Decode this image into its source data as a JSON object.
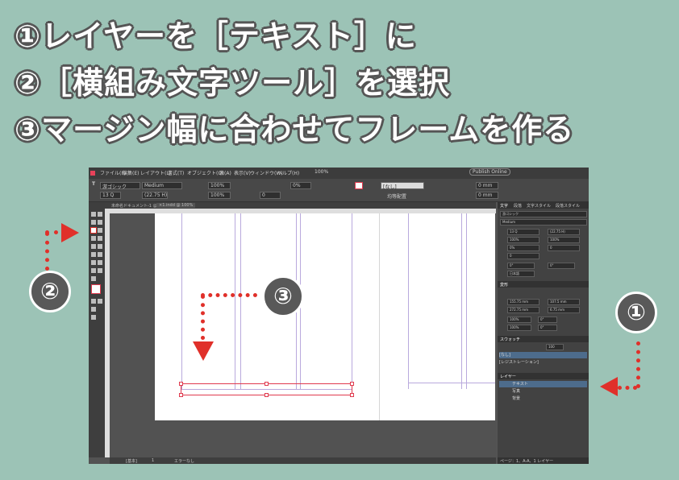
{
  "headings": {
    "line1": "①レイヤーを［テキスト］に",
    "line2": "②［横組み文字ツール］を選択",
    "line3": "③マージン幅に合わせてフレームを作る"
  },
  "badges": {
    "one": "①",
    "two": "②",
    "three": "③"
  },
  "colors": {
    "background": "#9cc3b6",
    "annotation_red": "#e0302a",
    "frame_red": "#e03a4e",
    "badge_gray": "#595959"
  },
  "app": {
    "menu": [
      "ファイル(F)",
      "編集(E)",
      "レイアウト(L)",
      "書式(T)",
      "オブジェクト(O)",
      "表(A)",
      "表示(V)",
      "ウィンドウ(W)",
      "ヘルプ(H)"
    ],
    "zoom": "100%",
    "publish_button": "Publish Online",
    "control": {
      "font": "游ゴシック",
      "style": "Medium",
      "size": "13 Q",
      "leading": "(22.75 H)",
      "scale_h": "100%",
      "scale_v": "100%",
      "tracking": "0",
      "tsume": "0%",
      "swatch": "[なし]",
      "grid_align": "均等配置",
      "inset": "0 mm"
    },
    "tabs": [
      "未命名ドキュメント-1 @ 100%",
      "×1.indd @ 100%"
    ],
    "statusbar": {
      "master": "[基本]",
      "page": "1",
      "errors": "エラーなし"
    },
    "panel": {
      "char_tabs": [
        "文字",
        "段落",
        "文字スタイル",
        "段落スタイル"
      ],
      "font": "游ゴシック",
      "style": "Medium",
      "size": "13 Q",
      "leading": "(22.75 H)",
      "tracking": "0",
      "scale": "100%",
      "tsume": "0%",
      "lang": "日本語",
      "transform_tab": "変形",
      "x": "155.75 mm",
      "y": "272.75 mm",
      "w": "107.5 mm",
      "h": "6.75 mm",
      "stroke_pct": "100%",
      "angle": "0°",
      "swatches_tab": "スウォッチ",
      "tint": "100",
      "swatch_items": [
        "[なし]",
        "[レジストレーション]"
      ],
      "layers_tab": "レイヤー",
      "layers": [
        "テキスト",
        "写真",
        "背景"
      ],
      "footer": "ページ：1、A-A、1 レイヤー"
    }
  }
}
